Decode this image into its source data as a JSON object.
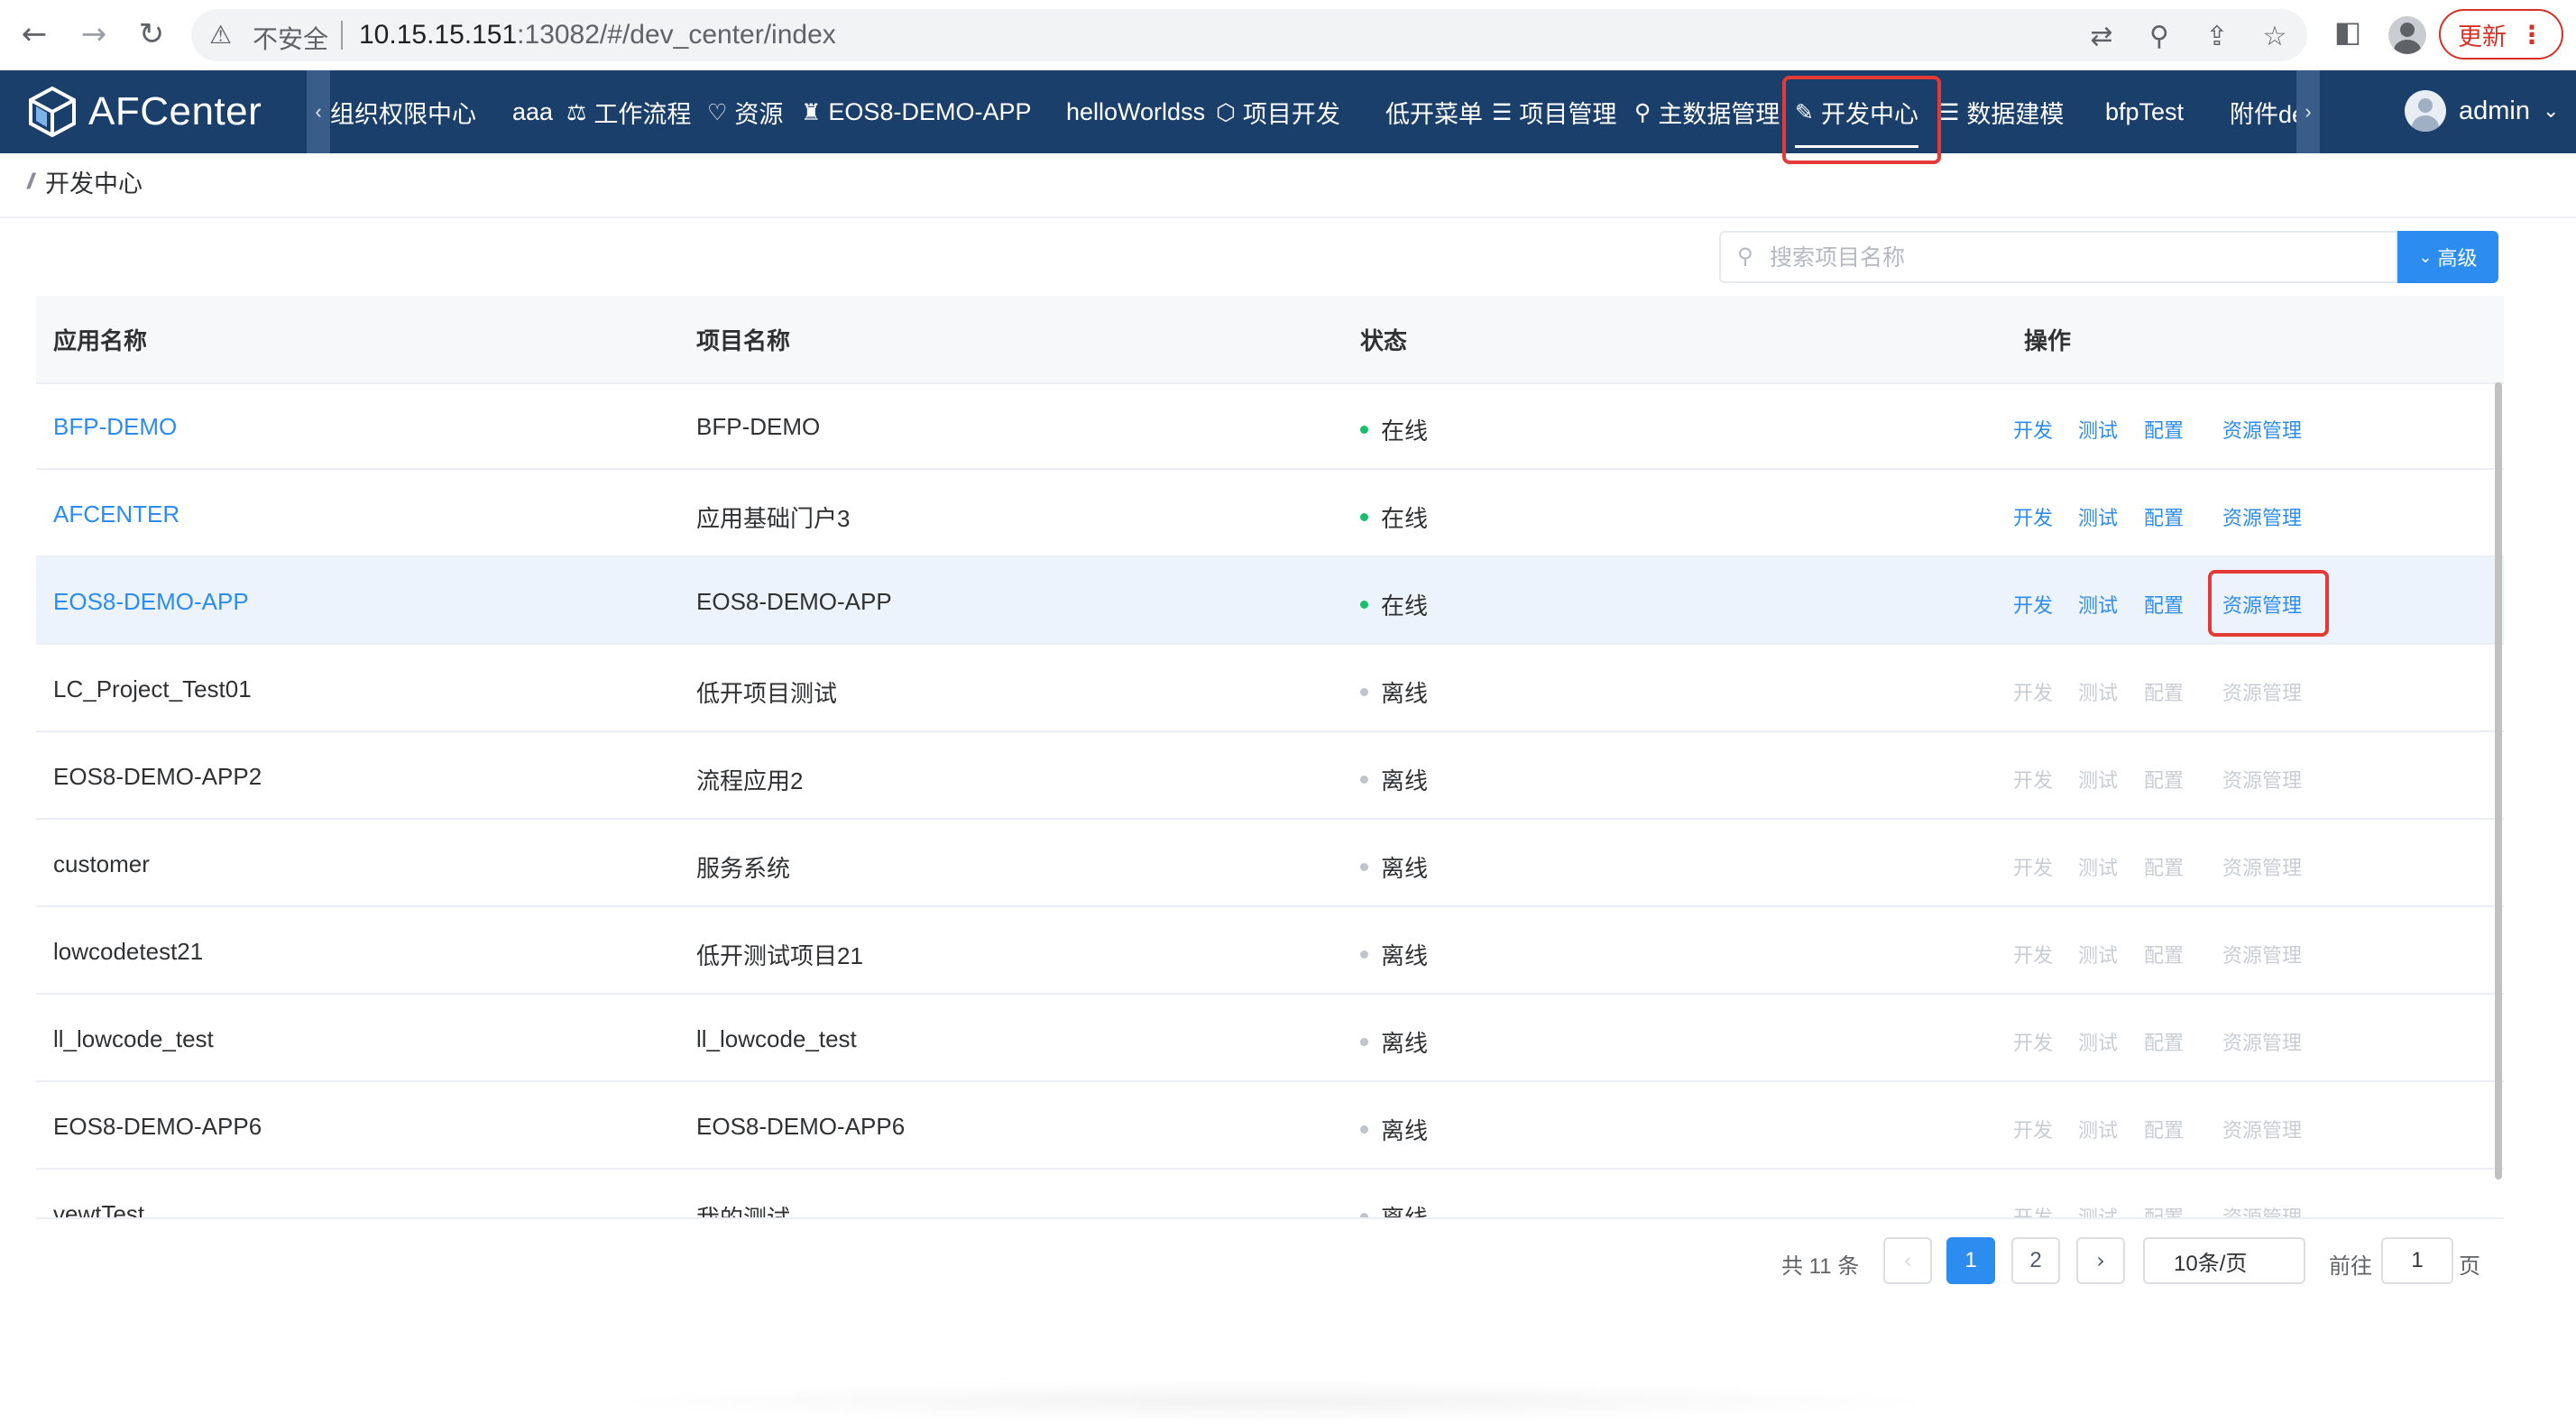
{
  "browser": {
    "security_label": "不安全",
    "url_host": "10.15.15.151",
    "url_rest": ":13082/#/dev_center/index",
    "update_label": "更新",
    "icons": [
      "back-arrow-icon",
      "forward-arrow-icon",
      "reload-icon",
      "warning-triangle-icon",
      "translate-icon",
      "zoom-icon",
      "share-icon",
      "bookmark-star-icon",
      "side-panel-icon",
      "profile-icon",
      "kebab-menu-icon"
    ]
  },
  "app": {
    "brand": "AFCenter",
    "nav_items": [
      {
        "label": "组织权限中心",
        "icon": ""
      },
      {
        "label": "aaa",
        "icon": ""
      },
      {
        "label": "工作流程",
        "icon": "⚖"
      },
      {
        "label": "资源",
        "icon": "♡"
      },
      {
        "label": "EOS8-DEMO-APP",
        "icon": "♜"
      },
      {
        "label": "helloWorldss",
        "icon": ""
      },
      {
        "label": "项目开发",
        "icon": "⬡"
      },
      {
        "label": "低开菜单",
        "icon": ""
      },
      {
        "label": "项目管理",
        "icon": "☰"
      },
      {
        "label": "主数据管理",
        "icon": "⚲"
      },
      {
        "label": "开发中心",
        "icon": "✎",
        "active": true
      },
      {
        "label": "数据建模",
        "icon": "☰"
      },
      {
        "label": "bfpTest",
        "icon": ""
      },
      {
        "label": "附件de",
        "icon": ""
      }
    ],
    "user": "admin"
  },
  "breadcrumb": {
    "title": "开发中心"
  },
  "search": {
    "placeholder": "搜索项目名称",
    "advanced_label": "高级"
  },
  "table": {
    "columns": [
      "应用名称",
      "项目名称",
      "状态",
      "操作"
    ],
    "actions": [
      "开发",
      "测试",
      "配置",
      "资源管理"
    ],
    "rows": [
      {
        "app": "BFP-DEMO",
        "project": "BFP-DEMO",
        "status": "在线",
        "online": true
      },
      {
        "app": "AFCENTER",
        "project": "应用基础门户3",
        "status": "在线",
        "online": true
      },
      {
        "app": "EOS8-DEMO-APP",
        "project": "EOS8-DEMO-APP",
        "status": "在线",
        "online": true,
        "hover": true
      },
      {
        "app": "LC_Project_Test01",
        "project": "低开项目测试",
        "status": "离线",
        "online": false
      },
      {
        "app": "EOS8-DEMO-APP2",
        "project": "流程应用2",
        "status": "离线",
        "online": false
      },
      {
        "app": "customer",
        "project": "服务系统",
        "status": "离线",
        "online": false
      },
      {
        "app": "lowcodetest21",
        "project": "低开测试项目21",
        "status": "离线",
        "online": false
      },
      {
        "app": "ll_lowcode_test",
        "project": "ll_lowcode_test",
        "status": "离线",
        "online": false
      },
      {
        "app": "EOS8-DEMO-APP6",
        "project": "EOS8-DEMO-APP6",
        "status": "离线",
        "online": false
      },
      {
        "app": "vewtTest",
        "project": "我的测试",
        "status": "离线",
        "online": false
      }
    ]
  },
  "pagination": {
    "total_text": "共 11 条",
    "pages": [
      "1",
      "2"
    ],
    "current": "1",
    "page_size": "10条/页",
    "goto_label": "前往",
    "goto_value": "1",
    "page_suffix": "页"
  }
}
